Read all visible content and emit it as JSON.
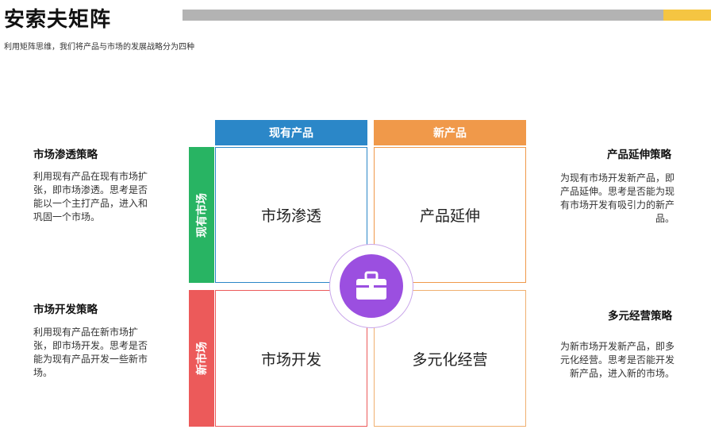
{
  "header": {
    "title": "安索夫矩阵",
    "subtitle": "利用矩阵思维，我们将产品与市场的发展战略分为四种"
  },
  "colors": {
    "gray_bar": "#b3b3b3",
    "yellow_bar": "#f5c542",
    "blue": "#2b87c8",
    "orange": "#f0994a",
    "green": "#28b463",
    "red": "#ec5a5a",
    "purple": "#9b4fe0"
  },
  "matrix": {
    "columns": [
      "现有产品",
      "新产品"
    ],
    "rows": [
      "现有市场",
      "新市场"
    ],
    "cells": {
      "existing_product_existing_market": "市场渗透",
      "new_product_existing_market": "产品延伸",
      "existing_product_new_market": "市场开发",
      "new_product_new_market": "多元化经营"
    },
    "center_icon": "briefcase-icon"
  },
  "strategies": {
    "penetration": {
      "title": "市场渗透策略",
      "lines": [
        "利用现有产品在现有市场扩",
        "张，即市场渗透。思考是否",
        "能以一个主打产品，进入和",
        "巩固一个市场。"
      ]
    },
    "extension": {
      "title": "产品延伸策略",
      "lines": [
        "为现有市场开发新产品，即",
        "产品延伸。思考是否能为现",
        "有市场开发有吸引力的新产",
        "品。"
      ]
    },
    "development": {
      "title": "市场开发策略",
      "lines": [
        "利用现有产品在新市场扩",
        "张，即市场开发。思考是否",
        "能为现有产品开发一些新市",
        "场。"
      ]
    },
    "diversification": {
      "title": "多元经营策略",
      "lines": [
        "为新市场开发新产品，即多",
        "元化经营。思考是否能开发",
        "新产品，进入新的市场。"
      ]
    }
  }
}
